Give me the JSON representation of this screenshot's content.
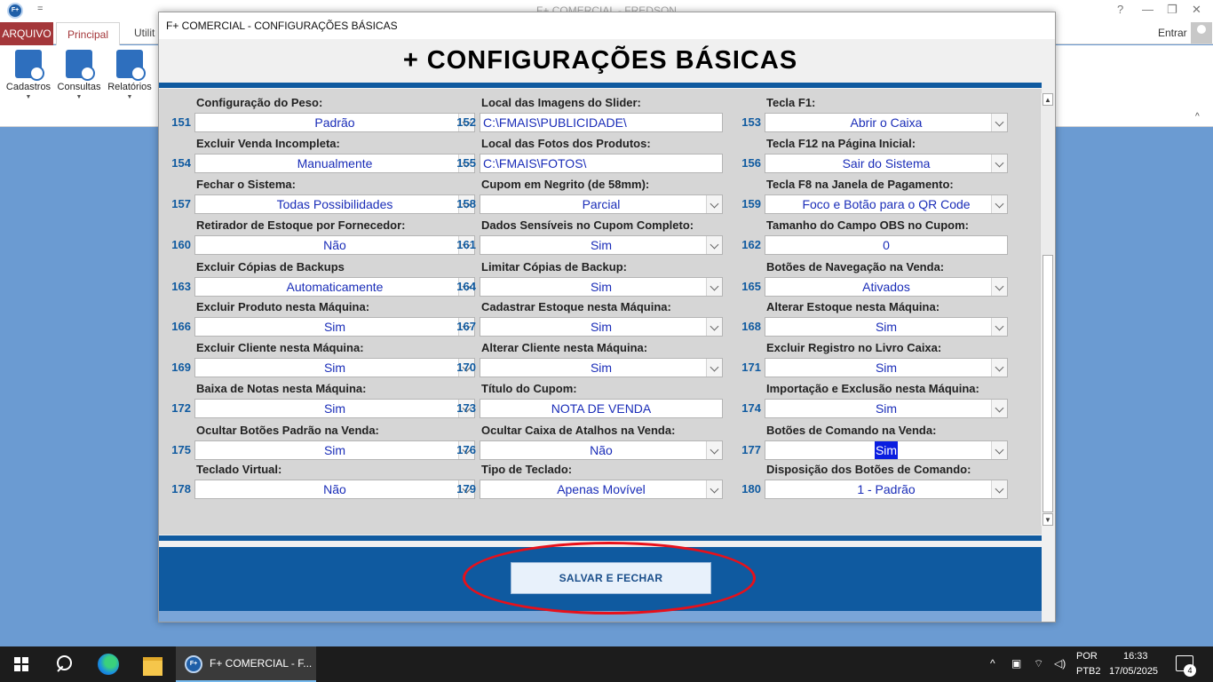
{
  "background_app": {
    "title": "F+ COMERCIAL - FREDSON",
    "app_icon": "F+",
    "qat": "=",
    "window_controls": [
      "?",
      "—",
      "❐",
      "✕"
    ],
    "tabs": [
      {
        "label": "ARQUIVO"
      },
      {
        "label": "Principal"
      },
      {
        "label": "Utilit"
      }
    ],
    "signin": "Entrar",
    "ribbon_buttons": [
      {
        "label": "Cadastros",
        "icon": "cadastros-icon"
      },
      {
        "label": "Consultas",
        "icon": "consultas-icon"
      },
      {
        "label": "Relatórios",
        "icon": "relatorios-icon"
      }
    ]
  },
  "dialog": {
    "title": "F+ COMERCIAL - CONFIGURAÇÕES BÁSICAS",
    "heading": "+ CONFIGURAÇÕES BÁSICAS",
    "save_button": "SALVAR E FECHAR",
    "fields": [
      {
        "num": "151",
        "label": "Configuração do Peso:",
        "value": "Padrão",
        "kind": "dropdown"
      },
      {
        "num": "152",
        "label": "Local das Imagens do Slider:",
        "value": "C:\\FMAIS\\PUBLICIDADE\\",
        "kind": "text"
      },
      {
        "num": "153",
        "label": "Tecla F1:",
        "value": "Abrir o Caixa",
        "kind": "dropdown"
      },
      {
        "num": "154",
        "label": "Excluir Venda Incompleta:",
        "value": "Manualmente",
        "kind": "dropdown"
      },
      {
        "num": "155",
        "label": "Local das Fotos dos Produtos:",
        "value": "C:\\FMAIS\\FOTOS\\",
        "kind": "text"
      },
      {
        "num": "156",
        "label": "Tecla F12 na Página Inicial:",
        "value": "Sair do Sistema",
        "kind": "dropdown"
      },
      {
        "num": "157",
        "label": "Fechar o Sistema:",
        "value": "Todas Possibilidades",
        "kind": "dropdown"
      },
      {
        "num": "158",
        "label": "Cupom em Negrito (de 58mm):",
        "value": "Parcial",
        "kind": "dropdown"
      },
      {
        "num": "159",
        "label": "Tecla F8 na Janela de Pagamento:",
        "value": "Foco e Botão para o QR Code",
        "kind": "dropdown"
      },
      {
        "num": "160",
        "label": "Retirador de Estoque por Fornecedor:",
        "value": "Não",
        "kind": "dropdown"
      },
      {
        "num": "161",
        "label": "Dados Sensíveis no Cupom Completo:",
        "value": "Sim",
        "kind": "dropdown"
      },
      {
        "num": "162",
        "label": "Tamanho do Campo OBS no Cupom:",
        "value": "0",
        "kind": "number"
      },
      {
        "num": "163",
        "label": "Excluir Cópias de Backups",
        "value": "Automaticamente",
        "kind": "dropdown"
      },
      {
        "num": "164",
        "label": "Limitar Cópias de Backup:",
        "value": "Sim",
        "kind": "dropdown"
      },
      {
        "num": "165",
        "label": "Botões de Navegação na Venda:",
        "value": "Ativados",
        "kind": "dropdown"
      },
      {
        "num": "166",
        "label": "Excluir Produto nesta Máquina:",
        "value": "Sim",
        "kind": "dropdown"
      },
      {
        "num": "167",
        "label": "Cadastrar Estoque nesta Máquina:",
        "value": "Sim",
        "kind": "dropdown"
      },
      {
        "num": "168",
        "label": "Alterar Estoque nesta Máquina:",
        "value": "Sim",
        "kind": "dropdown"
      },
      {
        "num": "169",
        "label": "Excluir Cliente nesta Máquina:",
        "value": "Sim",
        "kind": "dropdown"
      },
      {
        "num": "170",
        "label": "Alterar Cliente nesta Máquina:",
        "value": "Sim",
        "kind": "dropdown"
      },
      {
        "num": "171",
        "label": "Excluir Registro no Livro Caixa:",
        "value": "Sim",
        "kind": "dropdown"
      },
      {
        "num": "172",
        "label": "Baixa de Notas nesta Máquina:",
        "value": "Sim",
        "kind": "dropdown"
      },
      {
        "num": "173",
        "label": "Título do Cupom:",
        "value": "NOTA DE VENDA",
        "kind": "number"
      },
      {
        "num": "174",
        "label": "Importação e Exclusão nesta Máquina:",
        "value": "Sim",
        "kind": "dropdown"
      },
      {
        "num": "175",
        "label": "Ocultar Botões Padrão na Venda:",
        "value": "Sim",
        "kind": "dropdown"
      },
      {
        "num": "176",
        "label": "Ocultar Caixa de Atalhos na Venda:",
        "value": "Não",
        "kind": "dropdown"
      },
      {
        "num": "177",
        "label": "Botões de Comando na Venda:",
        "value": "Sim",
        "kind": "dropdown",
        "selected": true
      },
      {
        "num": "178",
        "label": "Teclado Virtual:",
        "value": "Não",
        "kind": "dropdown"
      },
      {
        "num": "179",
        "label": "Tipo de Teclado:",
        "value": "Apenas Movível",
        "kind": "dropdown"
      },
      {
        "num": "180",
        "label": "Disposição dos Botões de Comando:",
        "value": "1 - Padrão",
        "kind": "dropdown"
      }
    ]
  },
  "taskbar": {
    "active_app": "F+ COMERCIAL - F...",
    "language": "POR",
    "layout": "PTB2",
    "time": "16:33",
    "date": "17/05/2025",
    "notification_count": "4"
  },
  "colors": {
    "accent_blue": "#0f5aa0",
    "value_text": "#1a2db8",
    "highlight_ellipse": "#e8101a",
    "arquivo_tab": "#a4373a"
  }
}
